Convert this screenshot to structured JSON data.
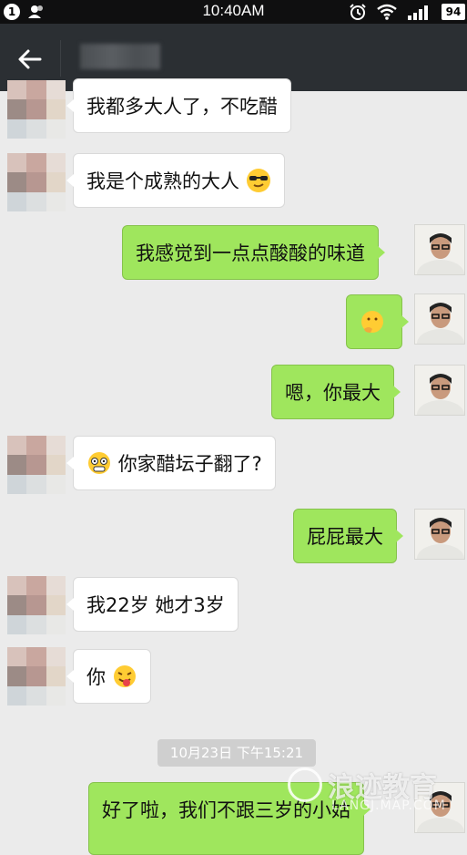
{
  "status_bar": {
    "notification_badge": "1",
    "time": "10:40AM",
    "battery": "94",
    "icons": [
      "person-icon",
      "alarm-icon",
      "wifi-icon",
      "signal-icon",
      "battery-icon"
    ]
  },
  "header": {
    "back_icon": "back-arrow-icon",
    "contact_name": ""
  },
  "messages": [
    {
      "side": "in",
      "text": "我都多大人了，不吃醋"
    },
    {
      "side": "in",
      "text": "我是个成熟的大人",
      "emoji": "sunglasses-emoji"
    },
    {
      "side": "out",
      "text": "我感觉到一点点酸酸的味道"
    },
    {
      "side": "out",
      "text": "",
      "emoji": "thinking-emoji"
    },
    {
      "side": "out",
      "text": "嗯，你最大"
    },
    {
      "side": "in",
      "text": "你家醋坛子翻了?",
      "emoji_prefix": "scared-emoji"
    },
    {
      "side": "out",
      "text": "屁屁最大"
    },
    {
      "side": "in",
      "text": "我22岁  她才3岁"
    },
    {
      "side": "in",
      "text": "你",
      "emoji": "tongue-emoji"
    },
    {
      "side": "out",
      "text": "好了啦，我们不跟三岁的小姑"
    }
  ],
  "timestamp": "10月23日 下午15:21",
  "watermark": {
    "text": "浪迹教育",
    "url": "LANGJ.MAP.COM"
  },
  "colors": {
    "outgoing_bubble": "#9fe65d",
    "incoming_bubble": "#ffffff",
    "header": "#2b2f33",
    "background": "#ebebeb"
  }
}
